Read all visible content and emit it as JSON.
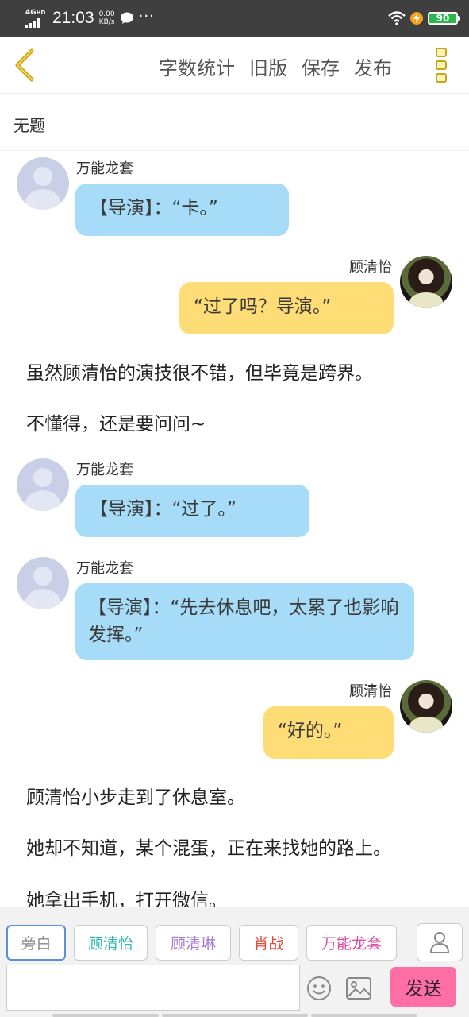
{
  "status_bar": {
    "network": "4G",
    "network_suffix": "HD",
    "time": "21:03",
    "speed_value": "0.00",
    "speed_unit": "KB/s",
    "more": "···",
    "battery": "90"
  },
  "nav": {
    "word_count": "字数统计",
    "old_version": "旧版",
    "save": "保存",
    "publish": "发布"
  },
  "doc": {
    "title": "无题"
  },
  "content": [
    {
      "kind": "left",
      "speaker": "万能龙套",
      "text": "【导演】：“卡。”"
    },
    {
      "kind": "right",
      "speaker": "顾清怡",
      "text": "“过了吗？导演。”"
    },
    {
      "kind": "narration",
      "text": "虽然顾清怡的演技很不错，但毕竟是跨界。"
    },
    {
      "kind": "narration",
      "text": "不懂得，还是要问问~"
    },
    {
      "kind": "left",
      "speaker": "万能龙套",
      "text": "【导演】：“过了。”"
    },
    {
      "kind": "left",
      "speaker": "万能龙套",
      "text": "【导演】：“先去休息吧，太累了也影响发挥。”"
    },
    {
      "kind": "right",
      "speaker": "顾清怡",
      "text": "“好的。”"
    },
    {
      "kind": "narration",
      "text": "顾清怡小步走到了休息室。"
    },
    {
      "kind": "narration",
      "text": "她却不知道，某个混蛋，正在来找她的路上。"
    },
    {
      "kind": "narration",
      "text": "她拿出手机，打开微信。"
    }
  ],
  "characters": [
    {
      "label": "旁白",
      "color": "#888888"
    },
    {
      "label": "顾清怡",
      "color": "#2ab7b0"
    },
    {
      "label": "顾清琳",
      "color": "#a57bd6"
    },
    {
      "label": "肖战",
      "color": "#e24a3b"
    },
    {
      "label": "万能龙套",
      "color": "#d94fa2"
    }
  ],
  "composer": {
    "placeholder": "",
    "send": "发送"
  },
  "colors": {
    "left_bubble": "#a7dcf8",
    "right_bubble": "#fedc76",
    "send_button": "#ff6fa6",
    "nav_menu": "#c9a41a"
  }
}
